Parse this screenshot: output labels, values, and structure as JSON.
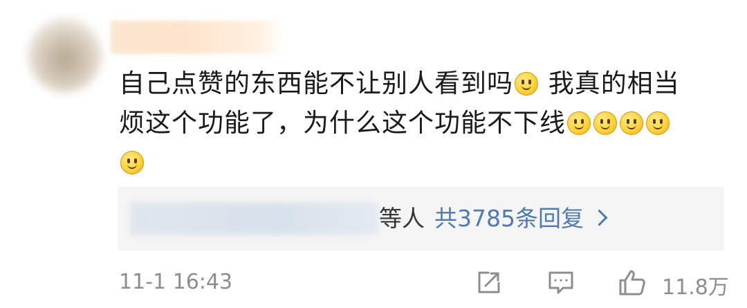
{
  "comment": {
    "line1_part1": "自己点赞的东西能不让别人看到吗",
    "line1_part2": "我真的相当",
    "line2": "烦这个功能了，为什么这个功能不下线",
    "emoji_name": "smile-emoji"
  },
  "replies": {
    "etc_label": "等人",
    "count_label": "共3785条回复"
  },
  "meta": {
    "timestamp": "11-1 16:43",
    "like_count": "11.8万"
  },
  "icons": {
    "share": "share-icon",
    "comment": "comment-icon",
    "like": "thumbs-up-icon",
    "chevron": "chevron-right-icon"
  },
  "colors": {
    "text": "#1a1a1a",
    "link": "#4c7bb4",
    "muted": "#8d8d8d",
    "reply_bg": "#f5f5f5"
  }
}
